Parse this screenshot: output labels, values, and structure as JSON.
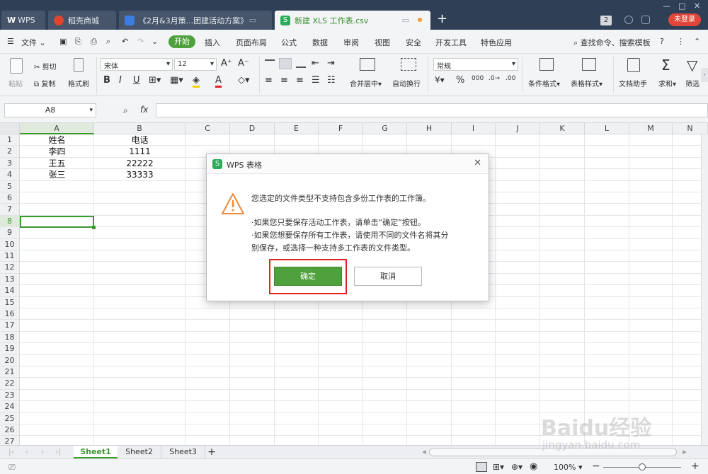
{
  "tabs": [
    {
      "label": "WPS"
    },
    {
      "label": "稻壳商城"
    },
    {
      "label": "《2月&3月策...团建活动方案》"
    },
    {
      "label": "新建 XLS 工作表.csv"
    }
  ],
  "window": {
    "badge": "2",
    "login": "未登录"
  },
  "menu": {
    "file": "文件",
    "items": [
      "开始",
      "插入",
      "页面布局",
      "公式",
      "数据",
      "审阅",
      "视图",
      "安全",
      "开发工具",
      "特色应用"
    ],
    "search": "查找命令、搜索模板"
  },
  "ribbon": {
    "paste": "粘贴",
    "cut": "剪切",
    "copy": "复制",
    "format_painter": "格式刷",
    "font_name": "宋体",
    "font_size": "12",
    "merge": "合并居中",
    "wrap": "自动换行",
    "number_format": "常规",
    "cond_format": "条件格式",
    "table_style": "表格样式",
    "doc_helper": "文档助手",
    "sum": "求和",
    "filter": "筛选"
  },
  "formula_bar": {
    "name_box": "A8",
    "fx": "fx",
    "value": ""
  },
  "columns": [
    "A",
    "B",
    "C",
    "D",
    "E",
    "F",
    "G",
    "H",
    "I",
    "J",
    "K",
    "L",
    "M",
    "N"
  ],
  "rows": [
    "1",
    "2",
    "3",
    "4",
    "5",
    "6",
    "7",
    "8",
    "9",
    "10",
    "11",
    "12",
    "13",
    "14",
    "15",
    "16",
    "17",
    "18",
    "19",
    "20",
    "21",
    "22",
    "23",
    "24",
    "25",
    "26",
    "27"
  ],
  "cells": [
    [
      "姓名",
      "电话"
    ],
    [
      "李四",
      "1111"
    ],
    [
      "王五",
      "22222"
    ],
    [
      "张三",
      "33333"
    ]
  ],
  "sheets": [
    "Sheet1",
    "Sheet2",
    "Sheet3"
  ],
  "status": {
    "zoom": "100%"
  },
  "dialog": {
    "title": "WPS 表格",
    "line1": "您选定的文件类型不支持包含多份工作表的工作簿。",
    "line2": "·如果您只要保存活动工作表，请单击“确定”按钮。",
    "line3": "·如果您想要保存所有工作表，请使用不同的文件名将其分",
    "line4": "别保存，或选择一种支持多工作表的文件类型。",
    "ok": "确定",
    "cancel": "取消"
  },
  "watermark": {
    "text": "Baidu经验",
    "url": "jingyan.baidu.com"
  },
  "colors": {
    "accent": "#4ea13c",
    "ok_button": "#4ea13c",
    "highlight_box": "#e02424",
    "tabbar": "#2f3f56",
    "login_badge": "#e0473a"
  }
}
